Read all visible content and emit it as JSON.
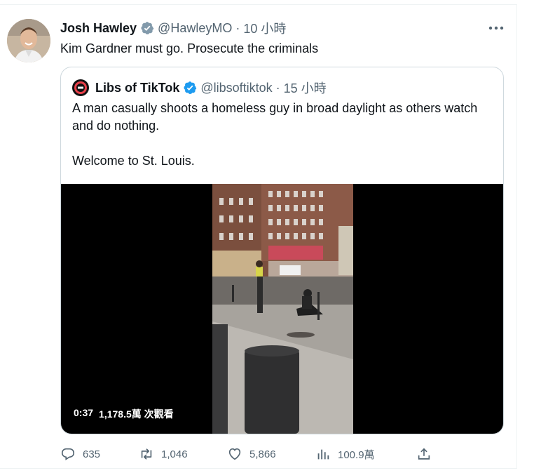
{
  "tweet": {
    "author_name": "Josh Hawley",
    "handle": "@HawleyMO",
    "dot": "·",
    "time": "10 小時",
    "text": "Kim Gardner must go. Prosecute the criminals",
    "verified_color": "#829aab"
  },
  "quoted": {
    "author_name": "Libs of TikTok",
    "handle": "@libsoftiktok",
    "dot": "·",
    "time": "15 小時",
    "text_line1": "A man casually shoots a homeless guy in broad daylight as others watch and do nothing.",
    "text_line2": "Welcome to St. Louis.",
    "verified_color": "#1d9bf0",
    "video": {
      "duration": "0:37",
      "views": "1,178.5萬 次觀看"
    }
  },
  "actions": {
    "reply_count": "635",
    "retweet_count": "1,046",
    "like_count": "5,866",
    "view_count": "100.9萬"
  },
  "colors": {
    "muted": "#536471",
    "border": "#cfd9de",
    "accent": "#1d9bf0"
  },
  "icons": [
    "more-icon",
    "verified-icon",
    "reply-icon",
    "retweet-icon",
    "like-icon",
    "views-icon",
    "share-icon",
    "play-video"
  ]
}
